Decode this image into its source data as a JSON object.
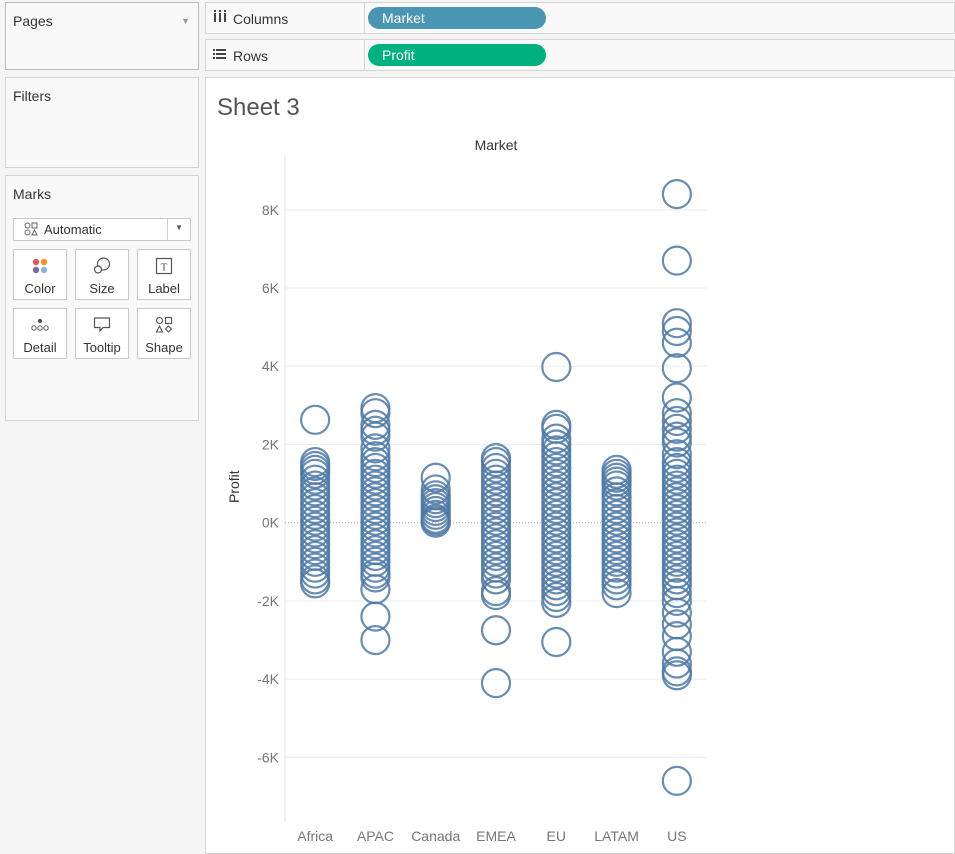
{
  "sidebar": {
    "pages": {
      "title": "Pages"
    },
    "filters": {
      "title": "Filters"
    },
    "marks": {
      "title": "Marks",
      "type": "Automatic",
      "buttons": [
        {
          "label": "Color",
          "icon": "color-icon"
        },
        {
          "label": "Size",
          "icon": "size-icon"
        },
        {
          "label": "Label",
          "icon": "label-icon"
        },
        {
          "label": "Detail",
          "icon": "detail-icon"
        },
        {
          "label": "Tooltip",
          "icon": "tooltip-icon"
        },
        {
          "label": "Shape",
          "icon": "shape-icon"
        }
      ]
    }
  },
  "shelves": {
    "columns": {
      "label": "Columns",
      "pill": "Market",
      "pill_color": "#4996b2"
    },
    "rows": {
      "label": "Rows",
      "pill": "Profit",
      "pill_color": "#00b180"
    }
  },
  "sheet": {
    "title": "Sheet 3"
  },
  "chart_data": {
    "type": "scatter",
    "mark": "circle-outline",
    "mark_color": "#4e79a7",
    "title": "",
    "header": "Market",
    "xlabel": "",
    "ylabel": "Profit",
    "categories": [
      "Africa",
      "APAC",
      "Canada",
      "EMEA",
      "EU",
      "LATAM",
      "US"
    ],
    "yticks": [
      8000,
      6000,
      4000,
      2000,
      0,
      -2000,
      -4000,
      -6000
    ],
    "ytick_labels": [
      "8K",
      "6K",
      "4K",
      "2K",
      "0K",
      "-2K",
      "-4K",
      "-6K"
    ],
    "ylim": [
      -7600,
      9400
    ],
    "grid": true,
    "zero_line": true,
    "series": [
      {
        "category": "Africa",
        "values": [
          2630,
          1550,
          1450,
          1350,
          1250,
          1100,
          950,
          800,
          650,
          500,
          350,
          200,
          50,
          -100,
          -250,
          -400,
          -550,
          -700,
          -850,
          -1000,
          -1150,
          -1300,
          -1450,
          -1550
        ]
      },
      {
        "category": "APAC",
        "values": [
          2930,
          2800,
          2500,
          2350,
          2200,
          1900,
          1700,
          1550,
          1400,
          1250,
          1100,
          950,
          800,
          650,
          500,
          350,
          200,
          50,
          -100,
          -250,
          -400,
          -550,
          -700,
          -850,
          -1000,
          -1150,
          -1300,
          -1400,
          -1700,
          -2400,
          -3000
        ]
      },
      {
        "category": "Canada",
        "values": [
          1150,
          850,
          700,
          600,
          500,
          400,
          300,
          200,
          100,
          50,
          0
        ]
      },
      {
        "category": "EMEA",
        "values": [
          1650,
          1550,
          1400,
          1250,
          1100,
          950,
          800,
          650,
          500,
          350,
          200,
          50,
          -100,
          -250,
          -400,
          -550,
          -700,
          -850,
          -1000,
          -1150,
          -1300,
          -1450,
          -1750,
          -1850,
          -2750,
          -4100
        ]
      },
      {
        "category": "EU",
        "values": [
          3980,
          2500,
          2400,
          2150,
          2000,
          1850,
          1700,
          1550,
          1400,
          1250,
          1100,
          950,
          800,
          650,
          500,
          350,
          200,
          50,
          -100,
          -250,
          -400,
          -550,
          -700,
          -850,
          -1000,
          -1150,
          -1300,
          -1450,
          -1600,
          -1750,
          -1900,
          -2050,
          -3050
        ]
      },
      {
        "category": "LATAM",
        "values": [
          1350,
          1250,
          1150,
          1050,
          950,
          800,
          650,
          500,
          350,
          200,
          50,
          -100,
          -250,
          -400,
          -550,
          -700,
          -850,
          -1000,
          -1150,
          -1300,
          -1450,
          -1600,
          -1800
        ]
      },
      {
        "category": "US",
        "values": [
          8400,
          6700,
          5100,
          4900,
          4600,
          3950,
          3200,
          2800,
          2600,
          2400,
          2200,
          2050,
          1750,
          1550,
          1400,
          1250,
          1100,
          950,
          800,
          650,
          500,
          350,
          200,
          50,
          -100,
          -250,
          -400,
          -550,
          -700,
          -850,
          -1000,
          -1150,
          -1300,
          -1450,
          -1600,
          -1800,
          -2000,
          -2300,
          -2600,
          -2900,
          -3300,
          -3600,
          -3800,
          -3900,
          -6600
        ]
      }
    ]
  }
}
